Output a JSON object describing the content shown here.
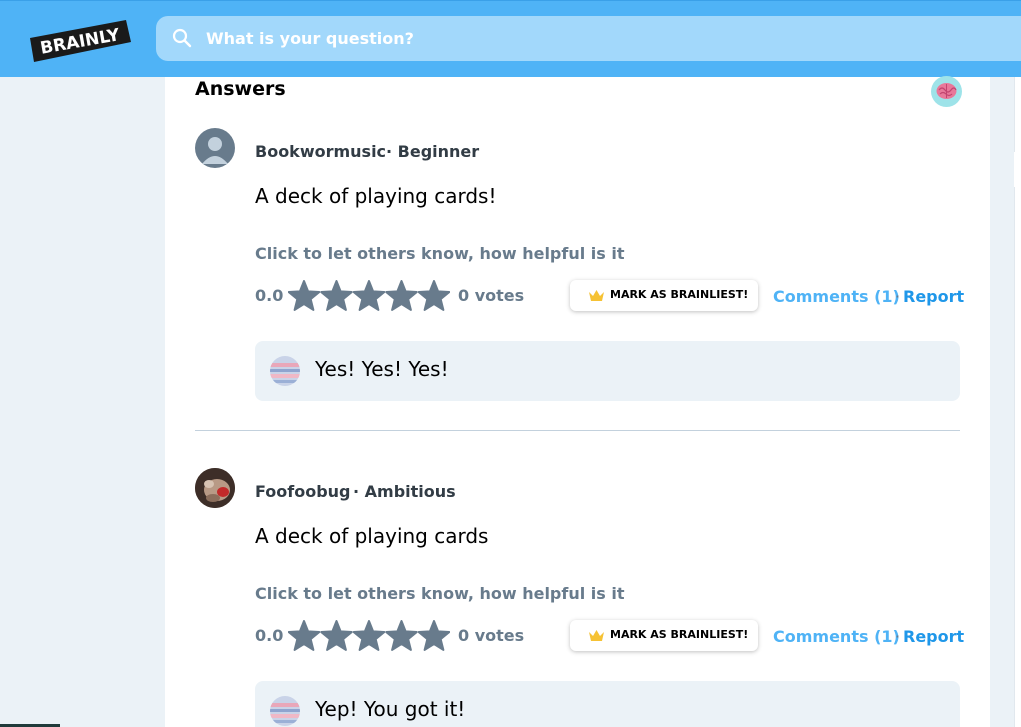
{
  "header": {
    "logo_text": "BRAINLY",
    "search_placeholder": "What is your question?"
  },
  "answers_section": {
    "title": "Answers"
  },
  "answers": [
    {
      "username": "Bookwormusic",
      "rank": "· Beginner",
      "text": "A deck of playing cards!",
      "helpful_prompt": "Click to let others know, how helpful is it",
      "rating": "0.0",
      "stars_filled": 0,
      "stars_total": 5,
      "votes": "0 votes",
      "brainliest_label": "MARK AS BRAINLIEST!",
      "comments_label": "Comments (1)",
      "separator": "·",
      "report_label": "Report",
      "comment": "Yes! Yes! Yes!"
    },
    {
      "username": "Foofoobug",
      "rank": "· Ambitious",
      "text": "A deck of playing cards",
      "helpful_prompt": "Click to let others know, how helpful is it",
      "rating": "0.0",
      "stars_filled": 0,
      "stars_total": 5,
      "votes": "0 votes",
      "brainliest_label": "MARK AS BRAINLIEST!",
      "comments_label": "Comments (1)",
      "separator": "·",
      "report_label": "Report",
      "comment": "Yep! You got it!"
    }
  ],
  "colors": {
    "header": "#4fb3f6",
    "search": "#a2d8fb",
    "link": "#4fb3f6",
    "report": "#1f97e9",
    "muted": "#687b8c",
    "star": "#687b8c",
    "crown": "#f6c234",
    "comment_bg": "#ebf2f7"
  }
}
